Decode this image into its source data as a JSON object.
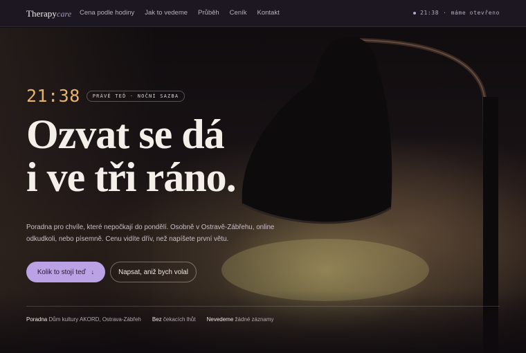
{
  "brand": {
    "name": "Therapy",
    "suffix": "care"
  },
  "nav": {
    "links": [
      "Cena podle hodiny",
      "Jak to vedeme",
      "Průběh",
      "Ceník",
      "Kontakt"
    ]
  },
  "status": {
    "time": "21:38",
    "text": "máme otevřeno",
    "dot_color": "#b99ce0"
  },
  "hero": {
    "clock": "21:38",
    "badge": "PRÁVĚ TEĎ · NOČNÍ SAZBA",
    "headline_line1": "Ozvat se dá",
    "headline_line2": "i ve tři ráno.",
    "lead": "Poradna pro chvíle, které nepočkají do pondělí. Osobně v Ostravě-Zábřehu, online odkudkoli, nebo písemně. Cenu vidíte dřív, než napíšete první větu.",
    "primary_button": "Kolik to stojí teď",
    "primary_arrow": "↓",
    "secondary_button": "Napsat, aniž bych volal",
    "accent_color": "#bba2e4",
    "clock_color": "#e3b36f"
  },
  "facts": [
    {
      "label": "Poradna",
      "value": "Dům kultury AKORD, Ostrava-Zábřeh"
    },
    {
      "label": "Bez",
      "value": "čekacích lhůt"
    },
    {
      "label": "Nevedeme",
      "value": "žádné záznamy"
    }
  ]
}
